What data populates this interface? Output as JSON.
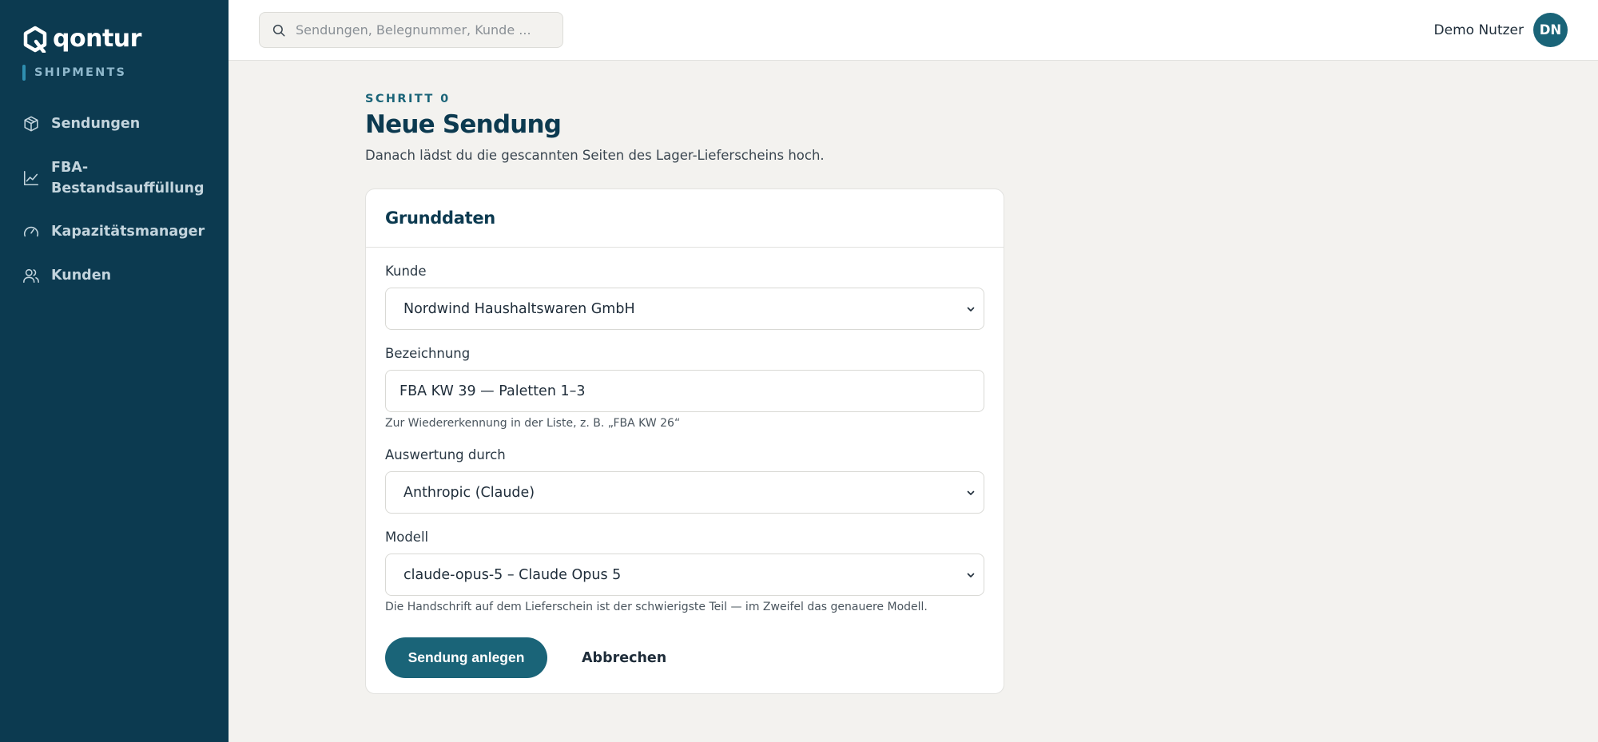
{
  "brand": {
    "name": "qontur",
    "subtitle": "SHIPMENTS"
  },
  "sidebar": {
    "items": [
      {
        "label": "Sendungen",
        "icon": "box-icon"
      },
      {
        "label": "FBA-Bestandsauffüllung",
        "icon": "chart-line-icon"
      },
      {
        "label": "Kapazitätsmanager",
        "icon": "gauge-icon"
      },
      {
        "label": "Kunden",
        "icon": "users-icon"
      }
    ]
  },
  "header": {
    "search_placeholder": "Sendungen, Belegnummer, Kunde ...",
    "user_name": "Demo Nutzer",
    "user_initials": "DN"
  },
  "page": {
    "step": "SCHRITT 0",
    "title": "Neue Sendung",
    "description": "Danach lädst du die gescannten Seiten des Lager-Lieferscheins hoch."
  },
  "form": {
    "card_title": "Grunddaten",
    "kunde": {
      "label": "Kunde",
      "value": "Nordwind Haushaltswaren GmbH"
    },
    "bezeichnung": {
      "label": "Bezeichnung",
      "value": "FBA KW 39 — Paletten 1–3",
      "hint": "Zur Wiedererkennung in der Liste, z. B. „FBA KW 26“"
    },
    "auswertung": {
      "label": "Auswertung durch",
      "value": "Anthropic (Claude)"
    },
    "modell": {
      "label": "Modell",
      "value": "claude-opus-5 – Claude Opus 5",
      "hint": "Die Handschrift auf dem Lieferschein ist der schwierigste Teil — im Zweifel das genauere Modell."
    },
    "submit_label": "Sendung anlegen",
    "cancel_label": "Abbrechen"
  },
  "colors": {
    "sidebar_bg": "#0c3a50",
    "accent": "#1a6478",
    "page_bg": "#f3f2ef"
  }
}
